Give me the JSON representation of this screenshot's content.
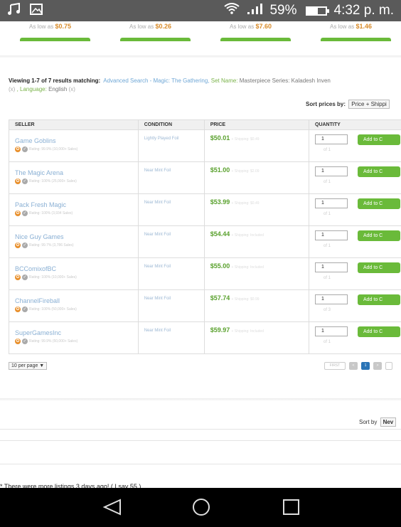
{
  "status_bar": {
    "battery": "59%",
    "battery_level": 0.59,
    "time": "4:32 p. m.",
    "icons": [
      "music-note-icon",
      "image-icon",
      "wifi-icon",
      "signal-icon",
      "battery-icon"
    ]
  },
  "top_prices": [
    {
      "prefix": "As low as",
      "price": "$0.75"
    },
    {
      "prefix": "As low as",
      "price": "$0.26"
    },
    {
      "prefix": "As low as",
      "price": "$7.60"
    },
    {
      "prefix": "As low as",
      "price": "$1.46"
    }
  ],
  "results": {
    "viewing": "Viewing 1-7 of 7 results matching:",
    "advanced": "Advanced Search - Magic: The Gathering,",
    "set_label": "Set Name:",
    "set_value": "Masterpiece Series: Kaladesh Inven",
    "remove1": "(x)",
    "language_label": ", Language:",
    "language_value": "English",
    "remove2": "(x)"
  },
  "sort": {
    "label": "Sort prices by:",
    "value": "Price + Shippi"
  },
  "table": {
    "headers": [
      "SELLER",
      "CONDITION",
      "PRICE",
      "QUANTITY"
    ],
    "add_label": "Add to C",
    "rows": [
      {
        "seller": "Game Goblins",
        "rating": "Rating: 99.9% (10,000+ Sales)",
        "condition": "Lightly Played Foil",
        "price": "$50.01",
        "shipping": "+ Shipping: $0.49",
        "qty": "1",
        "of": "of 1"
      },
      {
        "seller": "The Magic Arena",
        "rating": "Rating: 100% (25,000+ Sales)",
        "condition": "Near Mint Foil",
        "price": "$51.00",
        "shipping": "+ Shipping: $2.09",
        "qty": "1",
        "of": "of 1"
      },
      {
        "seller": "Pack Fresh Magic",
        "rating": "Rating: 100% (3,934 Sales)",
        "condition": "Near Mint Foil",
        "price": "$53.99",
        "shipping": "+ Shipping: $0.49",
        "qty": "1",
        "of": "of 1"
      },
      {
        "seller": "Nice Guy Games",
        "rating": "Rating: 99.7% (3,786 Sales)",
        "condition": "Near Mint Foil",
        "price": "$54.44",
        "shipping": "+ Shipping: Included",
        "qty": "1",
        "of": "of 1"
      },
      {
        "seller": "BCComixofBC",
        "rating": "Rating: 100% (10,000+ Sales)",
        "condition": "Near Mint Foil",
        "price": "$55.00",
        "shipping": "+ Shipping: Included",
        "qty": "1",
        "of": "of 1"
      },
      {
        "seller": "ChannelFireball",
        "rating": "Rating: 100% (50,000+ Sales)",
        "condition": "Near Mint Foil",
        "price": "$57.74",
        "shipping": "+ Shipping: $0.99",
        "qty": "1",
        "of": "of 3"
      },
      {
        "seller": "SuperGamesInc",
        "rating": "Rating: 99.9% (50,000+ Sales)",
        "condition": "Near Mint Foil",
        "price": "$59.97",
        "shipping": "+ Shipping: Included",
        "qty": "1",
        "of": "of 1"
      }
    ]
  },
  "per_page": "10 per page ▼",
  "pager": {
    "first": "FIRST",
    "prev": "<",
    "current": "1",
    "next": ">"
  },
  "sort2": {
    "label": "Sort by",
    "value": "Nev"
  },
  "footnote": "* There were more listings 3 days ago! ( I say 55 )",
  "colors": {
    "accent_green": "#6aba3a",
    "link_blue": "#6fa7d6",
    "price_green": "#5aa12e"
  }
}
